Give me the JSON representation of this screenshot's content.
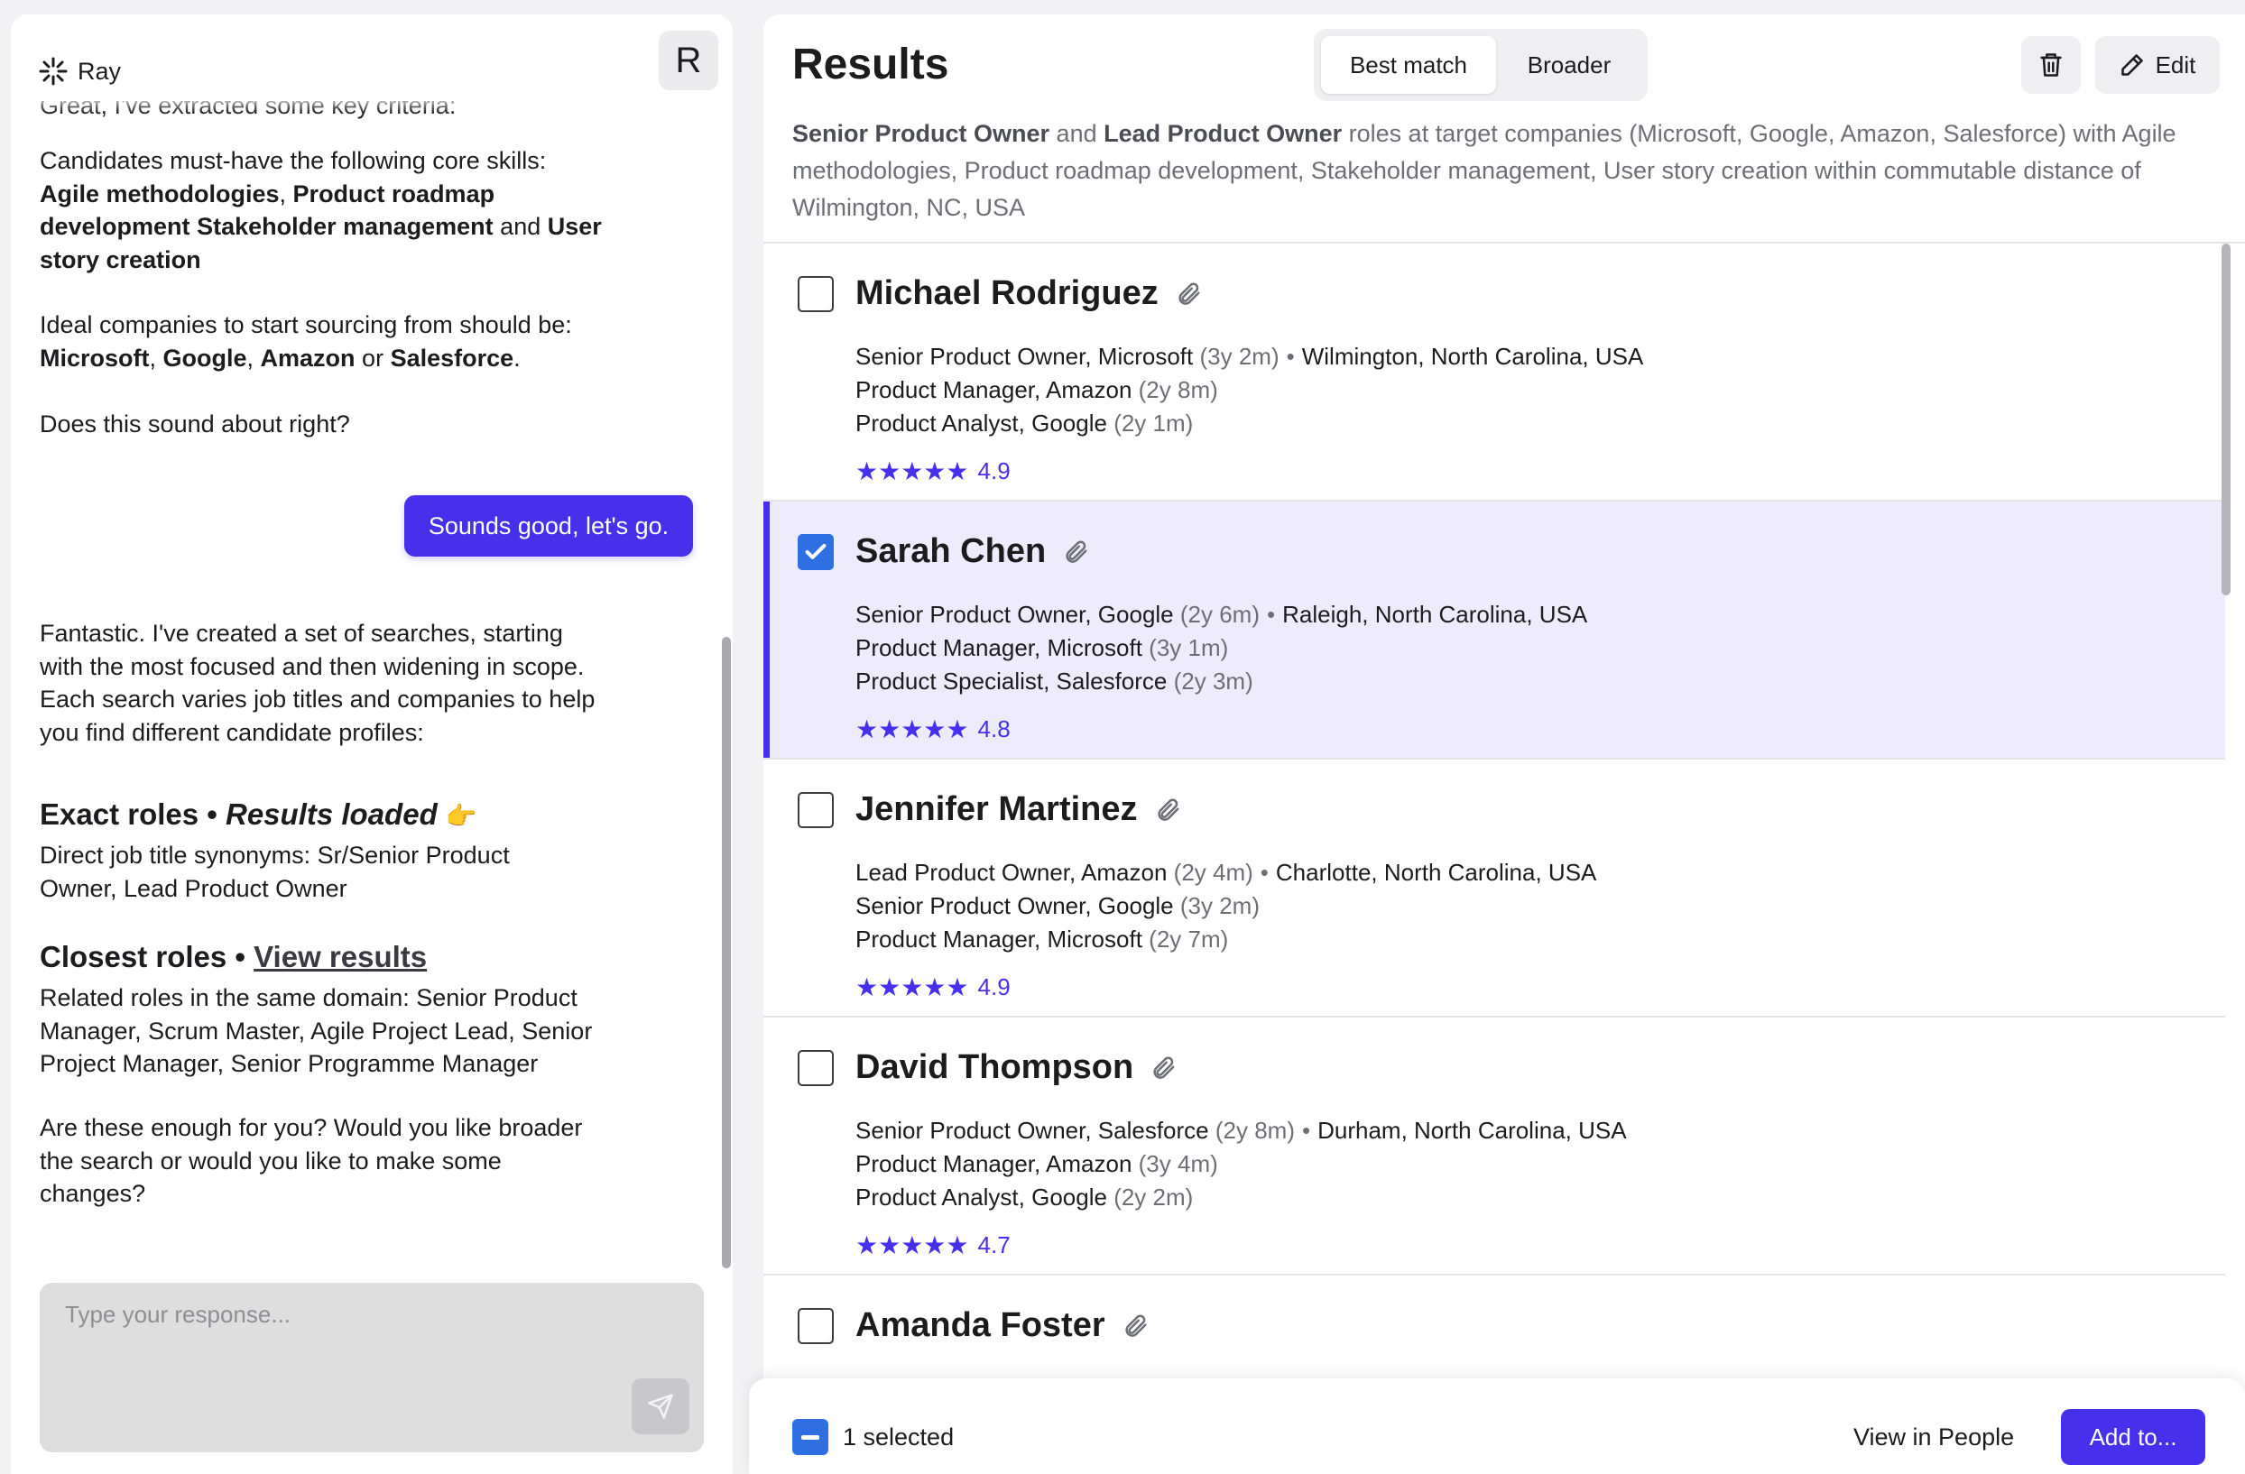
{
  "chat": {
    "brand_name": "Ray",
    "avatar_letter": "R",
    "cut_off_line": "Great, I've extracted some key criteria:",
    "skills_intro": "Candidates must-have the following core skills:",
    "skills": [
      "Agile methodologies",
      "Product roadmap development",
      "Stakeholder management",
      "User story creation"
    ],
    "companies_intro": "Ideal companies to start sourcing from should be:",
    "companies": [
      "Microsoft",
      "Google",
      "Amazon",
      "Salesforce"
    ],
    "question": "Does this sound about right?",
    "user_reply": "Sounds good, let's go.",
    "searches_intro": "Fantastic. I've created a set of searches, starting with the most focused and then widening in scope. Each search varies job titles and companies to help you find different candidate profiles:",
    "exact_roles_title": "Exact roles",
    "exact_roles_status": "Results loaded",
    "exact_roles_desc": "Direct job title synonyms: Sr/Senior Product Owner, Lead Product Owner",
    "closest_roles_title": "Closest roles",
    "closest_roles_link": "View results",
    "closest_roles_desc": "Related roles in the same domain: Senior Product Manager, Scrum Master, Agile Project Lead, Senior Project Manager, Senior Programme Manager",
    "closing_question": "Are these enough for you? Would you like broader the search or would you like to make some changes?",
    "input_placeholder": "Type your response..."
  },
  "results": {
    "title": "Results",
    "tabs": [
      "Best match",
      "Broader"
    ],
    "active_tab": "Best match",
    "edit_label": "Edit",
    "summary_parts": {
      "role1": "Senior Product Owner",
      "and": " and ",
      "role2": "Lead Product Owner",
      "rest": " roles at target companies (Microsoft, Google, Amazon, Salesforce) with Agile methodologies, Product roadmap development, Stakeholder management, User story creation within commutable distance of Wilmington, NC, USA"
    },
    "candidates": [
      {
        "name": "Michael Rodriguez",
        "selected": false,
        "jobs": [
          {
            "role": "Senior Product Owner, Microsoft",
            "duration": "(3y 2m)",
            "location": "Wilmington, North Carolina, USA"
          },
          {
            "role": "Product Manager, Amazon",
            "duration": "(2y 8m)"
          },
          {
            "role": "Product Analyst, Google",
            "duration": "(2y 1m)"
          }
        ],
        "stars": "★★★★★",
        "rating": "4.9"
      },
      {
        "name": "Sarah Chen",
        "selected": true,
        "jobs": [
          {
            "role": "Senior Product Owner, Google",
            "duration": "(2y 6m)",
            "location": "Raleigh, North Carolina, USA"
          },
          {
            "role": "Product Manager, Microsoft",
            "duration": "(3y 1m)"
          },
          {
            "role": "Product Specialist, Salesforce",
            "duration": "(2y 3m)"
          }
        ],
        "stars": "★★★★★",
        "rating": "4.8"
      },
      {
        "name": "Jennifer Martinez",
        "selected": false,
        "jobs": [
          {
            "role": "Lead Product Owner, Amazon",
            "duration": "(2y 4m)",
            "location": "Charlotte, North Carolina, USA"
          },
          {
            "role": "Senior Product Owner, Google",
            "duration": "(3y 2m)"
          },
          {
            "role": "Product Manager, Microsoft",
            "duration": "(2y 7m)"
          }
        ],
        "stars": "★★★★★",
        "rating": "4.9"
      },
      {
        "name": "David Thompson",
        "selected": false,
        "jobs": [
          {
            "role": "Senior Product Owner, Salesforce",
            "duration": "(2y 8m)",
            "location": "Durham, North Carolina, USA"
          },
          {
            "role": "Product Manager, Amazon",
            "duration": "(3y 4m)"
          },
          {
            "role": "Product Analyst, Google",
            "duration": "(2y 2m)"
          }
        ],
        "stars": "★★★★★",
        "rating": "4.7"
      },
      {
        "name": "Amanda Foster",
        "selected": false,
        "jobs": []
      }
    ]
  },
  "action_bar": {
    "selected_count": "1 selected",
    "view_in_people": "View in People",
    "add_to": "Add to..."
  },
  "colors": {
    "accent": "#4630eb",
    "checkbox_blue": "#2f6fe4",
    "selected_row": "#edebfc"
  }
}
